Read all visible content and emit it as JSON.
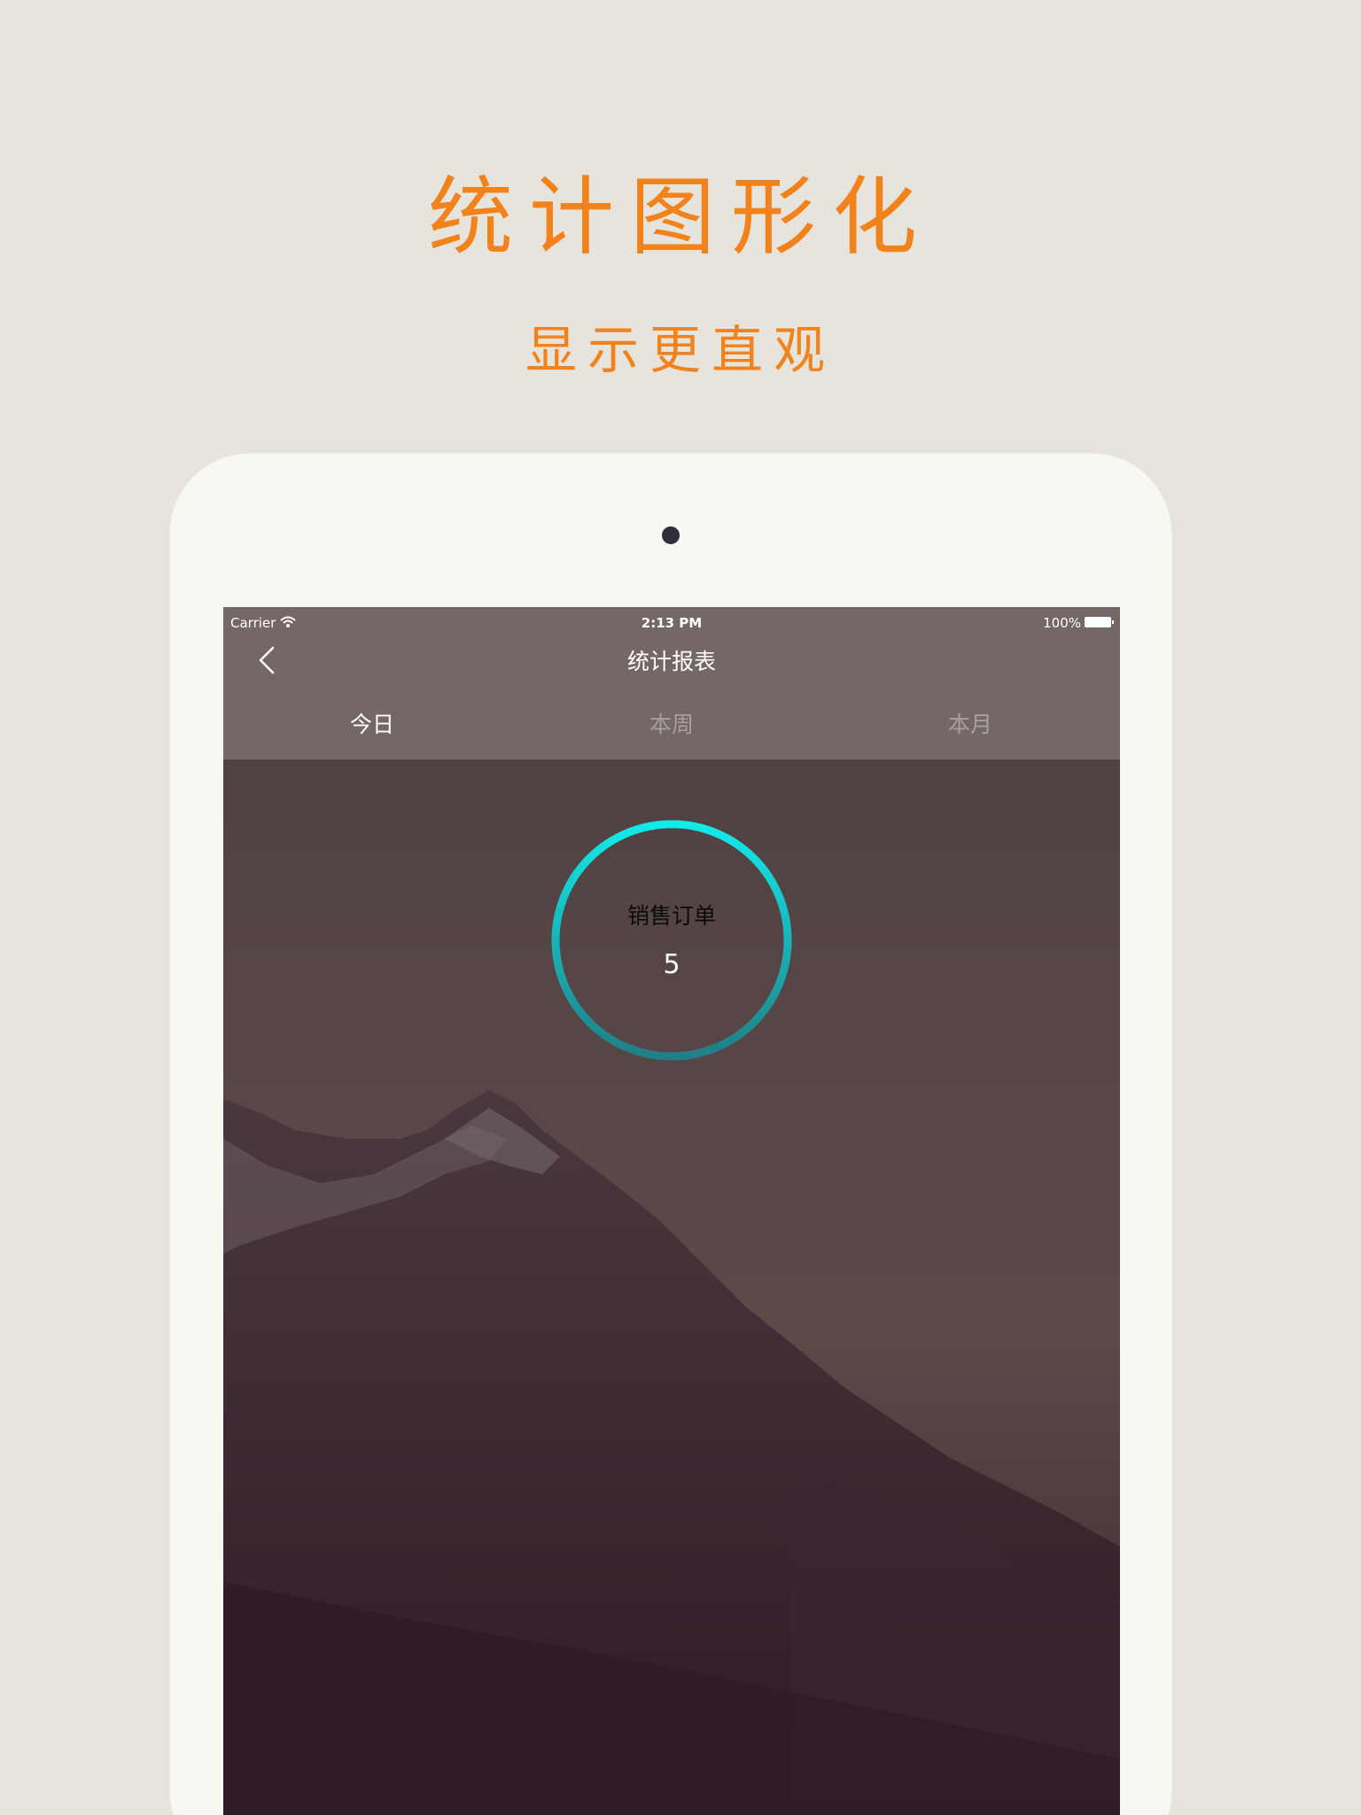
{
  "promo": {
    "title": "统计图形化",
    "subtitle": "显示更直观",
    "accent_color": "#f2831c"
  },
  "status_bar": {
    "carrier": "Carrier",
    "time": "2:13 PM",
    "battery": "100%"
  },
  "nav": {
    "back_icon": "chevron-left-icon",
    "title": "统计报表"
  },
  "tabs": [
    {
      "label": "今日",
      "active": true
    },
    {
      "label": "本周",
      "active": false
    },
    {
      "label": "本月",
      "active": false
    }
  ],
  "stat_ring": {
    "label": "销售订单",
    "value": "5",
    "ring_color_top": "#12eaea",
    "ring_color_bottom": "#1f7f86"
  }
}
